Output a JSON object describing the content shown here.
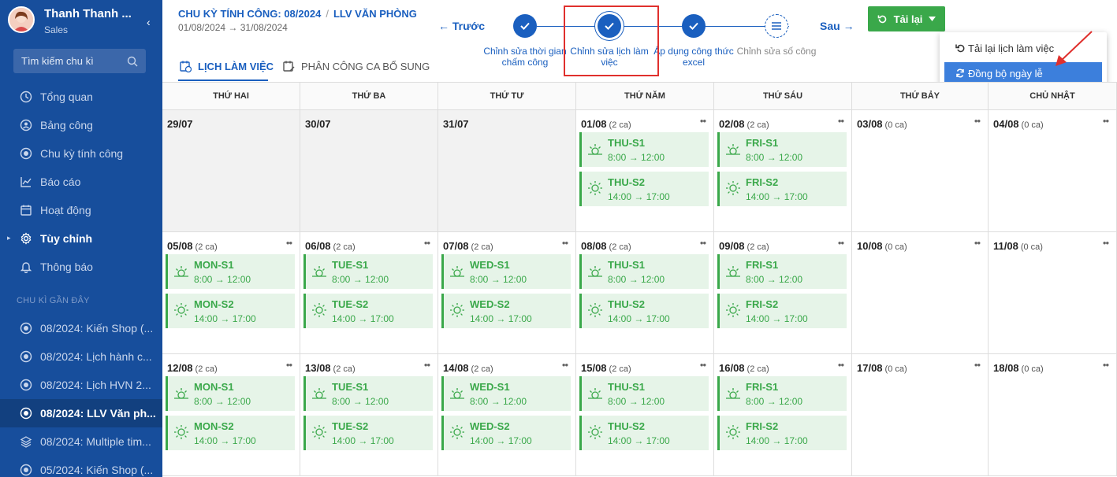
{
  "sidebar": {
    "user_name": "Thanh Thanh ...",
    "user_role": "Sales",
    "collapse_icon": "‹",
    "search_placeholder": "Tìm kiếm chu kì",
    "menu": [
      {
        "label": "Tổng quan",
        "icon": "clock-icon"
      },
      {
        "label": "Bảng công",
        "icon": "user-icon"
      },
      {
        "label": "Chu kỳ tính công",
        "icon": "circle-icon"
      },
      {
        "label": "Báo cáo",
        "icon": "chart-icon"
      },
      {
        "label": "Hoạt động",
        "icon": "calendar-icon"
      },
      {
        "label": "Tùy chỉnh",
        "icon": "gear-icon"
      },
      {
        "label": "Thông báo",
        "icon": "bell-icon"
      }
    ],
    "recent_title": "CHU KÌ GẦN ĐÂY",
    "recent": [
      "08/2024: Kiến Shop (...",
      "08/2024: Lịch hành c...",
      "08/2024: Lịch HVN 2...",
      "08/2024: LLV Văn ph...",
      "08/2024: Multiple tim...",
      "05/2024: Kiến Shop (..."
    ]
  },
  "header": {
    "breadcrumb_1": "CHU KỲ TÍNH CÔNG: 08/2024",
    "breadcrumb_sep": "/",
    "breadcrumb_2": "LLV VĂN PHÒNG",
    "date_range": "01/08/2024 → 31/08/2024",
    "tabs": [
      "LỊCH LÀM VIỆC",
      "PHÂN CÔNG CA BỔ SUNG"
    ]
  },
  "stepper": {
    "prev": "← Trước",
    "next": "Sau →",
    "steps": [
      "Chỉnh sửa thời gian chấm công",
      "Chỉnh sửa lịch làm việc",
      "Áp dụng công thức excel",
      "Chỉnh sửa số công"
    ]
  },
  "actions": {
    "reload_label": "Tải lại",
    "menu": [
      "Tải lại lịch làm việc",
      "Đồng bộ ngày lễ"
    ]
  },
  "colors": {
    "sidebar": "#174e9c",
    "accent": "#1a5fbf",
    "green": "#3aa84a",
    "highlight": "#e0302d"
  },
  "calendar": {
    "weekdays": [
      "THỨ HAI",
      "THỨ BA",
      "THỨ TƯ",
      "THỨ NĂM",
      "THỨ SÁU",
      "THỨ BẢY",
      "CHỦ NHẬT"
    ],
    "weeks": [
      [
        {
          "date": "29/07",
          "count": "",
          "past": true,
          "shifts": []
        },
        {
          "date": "30/07",
          "count": "",
          "past": true,
          "shifts": []
        },
        {
          "date": "31/07",
          "count": "",
          "past": true,
          "shifts": []
        },
        {
          "date": "01/08",
          "count": "(2 ca)",
          "shifts": [
            {
              "name": "THU-S1",
              "time": "8:00 → 12:00"
            },
            {
              "name": "THU-S2",
              "time": "14:00 → 17:00"
            }
          ]
        },
        {
          "date": "02/08",
          "count": "(2 ca)",
          "shifts": [
            {
              "name": "FRI-S1",
              "time": "8:00 → 12:00"
            },
            {
              "name": "FRI-S2",
              "time": "14:00 → 17:00"
            }
          ]
        },
        {
          "date": "03/08",
          "count": "(0 ca)",
          "shifts": []
        },
        {
          "date": "04/08",
          "count": "(0 ca)",
          "shifts": []
        }
      ],
      [
        {
          "date": "05/08",
          "count": "(2 ca)",
          "shifts": [
            {
              "name": "MON-S1",
              "time": "8:00 → 12:00"
            },
            {
              "name": "MON-S2",
              "time": "14:00 → 17:00"
            }
          ]
        },
        {
          "date": "06/08",
          "count": "(2 ca)",
          "shifts": [
            {
              "name": "TUE-S1",
              "time": "8:00 → 12:00"
            },
            {
              "name": "TUE-S2",
              "time": "14:00 → 17:00"
            }
          ]
        },
        {
          "date": "07/08",
          "count": "(2 ca)",
          "shifts": [
            {
              "name": "WED-S1",
              "time": "8:00 → 12:00"
            },
            {
              "name": "WED-S2",
              "time": "14:00 → 17:00"
            }
          ]
        },
        {
          "date": "08/08",
          "count": "(2 ca)",
          "shifts": [
            {
              "name": "THU-S1",
              "time": "8:00 → 12:00"
            },
            {
              "name": "THU-S2",
              "time": "14:00 → 17:00"
            }
          ]
        },
        {
          "date": "09/08",
          "count": "(2 ca)",
          "shifts": [
            {
              "name": "FRI-S1",
              "time": "8:00 → 12:00"
            },
            {
              "name": "FRI-S2",
              "time": "14:00 → 17:00"
            }
          ]
        },
        {
          "date": "10/08",
          "count": "(0 ca)",
          "shifts": []
        },
        {
          "date": "11/08",
          "count": "(0 ca)",
          "shifts": []
        }
      ],
      [
        {
          "date": "12/08",
          "count": "(2 ca)",
          "shifts": [
            {
              "name": "MON-S1",
              "time": "8:00 → 12:00"
            },
            {
              "name": "MON-S2",
              "time": "14:00 → 17:00"
            }
          ]
        },
        {
          "date": "13/08",
          "count": "(2 ca)",
          "shifts": [
            {
              "name": "TUE-S1",
              "time": "8:00 → 12:00"
            },
            {
              "name": "TUE-S2",
              "time": "14:00 → 17:00"
            }
          ]
        },
        {
          "date": "14/08",
          "count": "(2 ca)",
          "shifts": [
            {
              "name": "WED-S1",
              "time": "8:00 → 12:00"
            },
            {
              "name": "WED-S2",
              "time": "14:00 → 17:00"
            }
          ]
        },
        {
          "date": "15/08",
          "count": "(2 ca)",
          "shifts": [
            {
              "name": "THU-S1",
              "time": "8:00 → 12:00"
            },
            {
              "name": "THU-S2",
              "time": "14:00 → 17:00"
            }
          ]
        },
        {
          "date": "16/08",
          "count": "(2 ca)",
          "shifts": [
            {
              "name": "FRI-S1",
              "time": "8:00 → 12:00"
            },
            {
              "name": "FRI-S2",
              "time": "14:00 → 17:00"
            }
          ]
        },
        {
          "date": "17/08",
          "count": "(0 ca)",
          "shifts": []
        },
        {
          "date": "18/08",
          "count": "(0 ca)",
          "shifts": []
        }
      ]
    ]
  }
}
